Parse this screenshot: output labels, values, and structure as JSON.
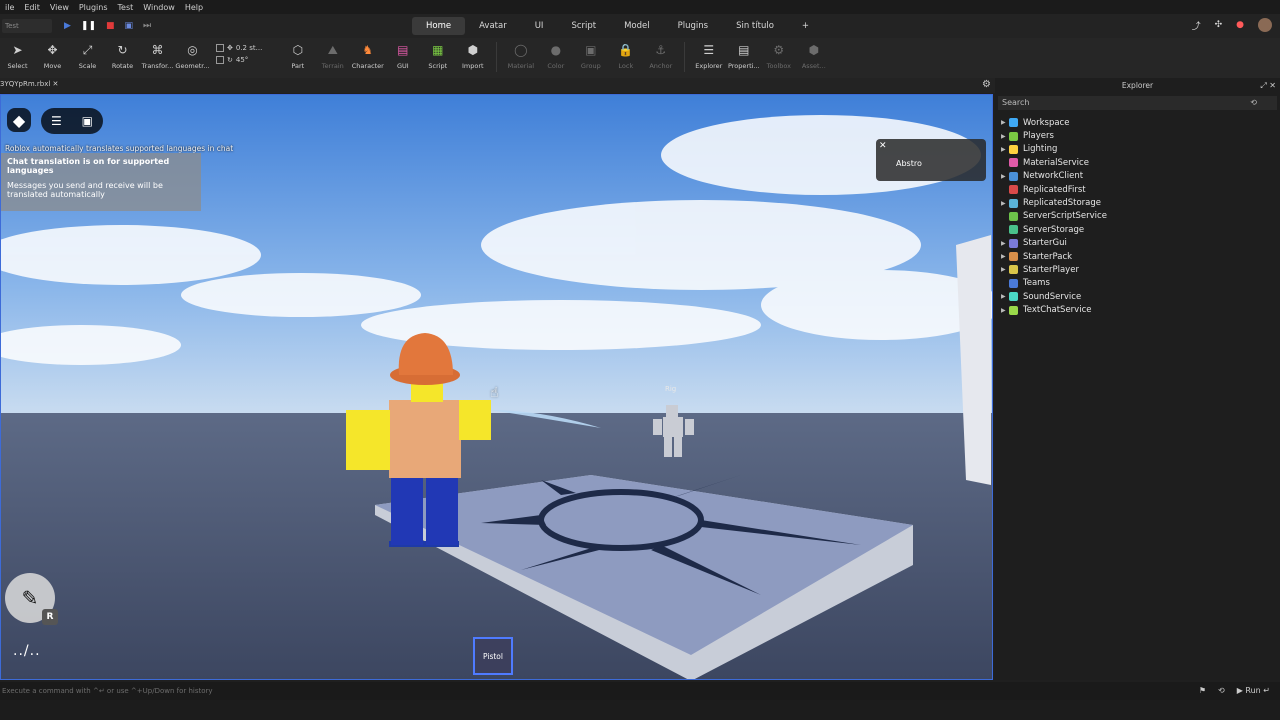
{
  "menu": [
    "ile",
    "Edit",
    "View",
    "Plugins",
    "Test",
    "Window",
    "Help"
  ],
  "test_selector": "Test",
  "tabs": [
    {
      "label": "Home",
      "active": true
    },
    {
      "label": "Avatar"
    },
    {
      "label": "UI"
    },
    {
      "label": "Script"
    },
    {
      "label": "Model"
    },
    {
      "label": "Plugins"
    },
    {
      "label": "Sin título"
    }
  ],
  "add_tab": "+",
  "toolbar": {
    "select": "Select",
    "move": "Move",
    "scale": "Scale",
    "rotate": "Rotate",
    "transform": "Transfor...",
    "geometry": "Geometr...",
    "snap_move": "0.2 st...",
    "snap_rotate": "45°",
    "part": "Part",
    "terrain": "Terrain",
    "character": "Character",
    "gui": "GUI",
    "script": "Script",
    "import": "Import",
    "material": "Material",
    "color": "Color",
    "group": "Group",
    "lock": "Lock",
    "anchor": "Anchor",
    "explorer": "Explorer",
    "properties": "Properti...",
    "toolbox": "Toolbox",
    "assets": "Asset..."
  },
  "doc_tab": "3YQYpRm.rbxl",
  "viewport": {
    "chat_note": "Roblox automatically translates supported languages in chat",
    "chat_title": "Chat translation is on for supported languages",
    "chat_body": "Messages you send and receive will be translated automatically",
    "player_name": "Abstro",
    "rig_label": "Rig",
    "hotbar_item": "Pistol",
    "tool_key": "R",
    "ping": "../.."
  },
  "explorer": {
    "title": "Explorer",
    "search_placeholder": "Search",
    "items": [
      {
        "name": "Workspace",
        "color": "#3fa9f5",
        "expand": true
      },
      {
        "name": "Players",
        "color": "#7ac943",
        "expand": true
      },
      {
        "name": "Lighting",
        "color": "#ffd23f",
        "expand": true
      },
      {
        "name": "MaterialService",
        "color": "#e05aa8",
        "expand": false
      },
      {
        "name": "NetworkClient",
        "color": "#4a90d9",
        "expand": true
      },
      {
        "name": "ReplicatedFirst",
        "color": "#d94a4a",
        "expand": false
      },
      {
        "name": "ReplicatedStorage",
        "color": "#5ab4d9",
        "expand": true
      },
      {
        "name": "ServerScriptService",
        "color": "#6cc24a",
        "expand": false
      },
      {
        "name": "ServerStorage",
        "color": "#4ac28c",
        "expand": false
      },
      {
        "name": "StarterGui",
        "color": "#7a7ad9",
        "expand": true
      },
      {
        "name": "StarterPack",
        "color": "#d98f4a",
        "expand": true
      },
      {
        "name": "StarterPlayer",
        "color": "#d9c54a",
        "expand": true
      },
      {
        "name": "Teams",
        "color": "#4a7ad9",
        "expand": false
      },
      {
        "name": "SoundService",
        "color": "#4ad9c5",
        "expand": true
      },
      {
        "name": "TextChatService",
        "color": "#9ad94a",
        "expand": true
      }
    ]
  },
  "command_bar": {
    "placeholder": "Execute a command with ^↵ or use ^+Up/Down for history",
    "run": "Run"
  }
}
